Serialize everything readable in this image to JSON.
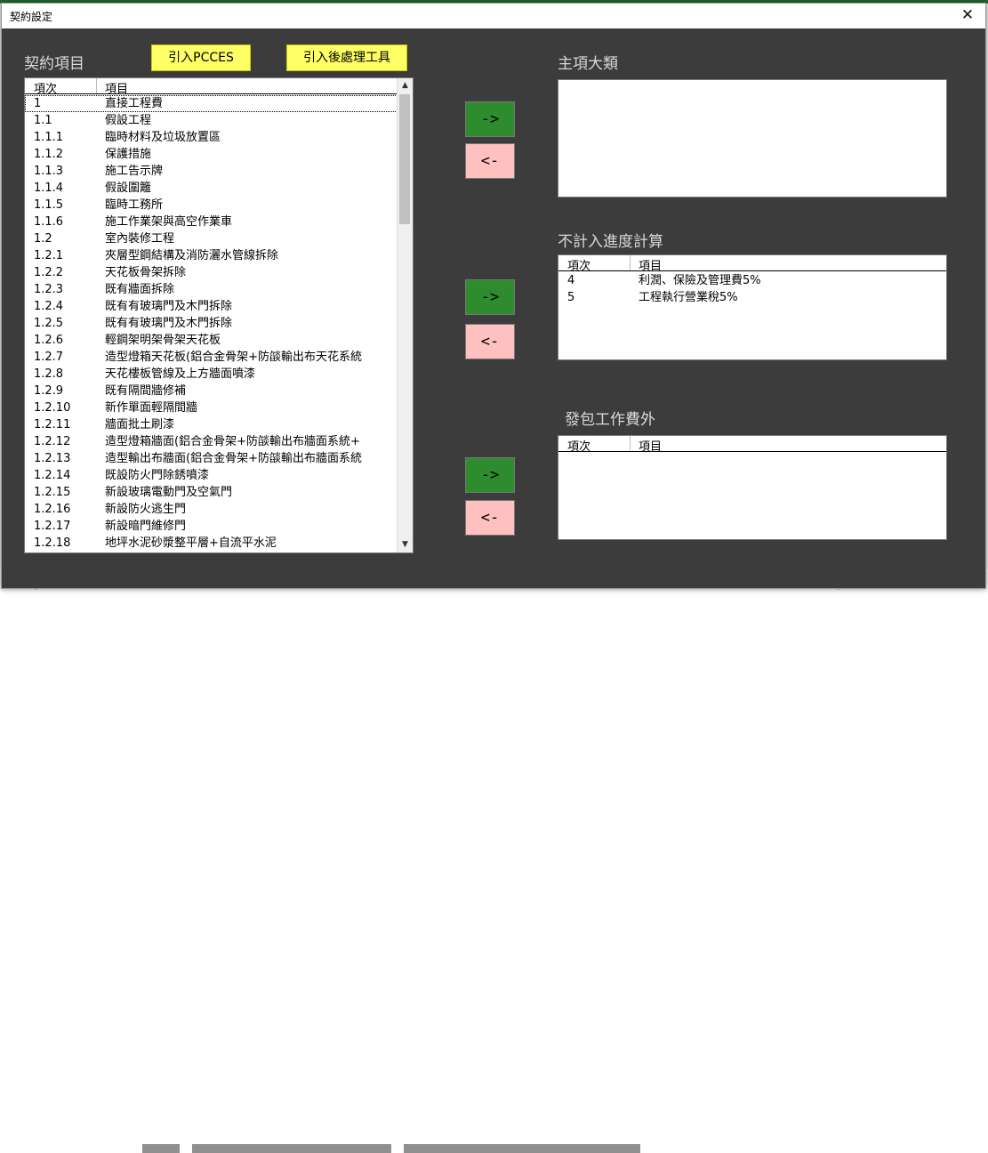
{
  "window": {
    "title": "契約設定",
    "close_symbol": "✕"
  },
  "left": {
    "label": "契約項目",
    "import_pcces": "引入PCCES",
    "import_post": "引入後處理工具",
    "headers": {
      "col1": "項次",
      "col2": "項目"
    },
    "rows": [
      {
        "no": "1",
        "name": "直接工程費"
      },
      {
        "no": "1.1",
        "name": "假設工程"
      },
      {
        "no": "1.1.1",
        "name": "臨時材料及垃圾放置區"
      },
      {
        "no": "1.1.2",
        "name": "保護措施"
      },
      {
        "no": "1.1.3",
        "name": "施工告示牌"
      },
      {
        "no": "1.1.4",
        "name": "假設圍籬"
      },
      {
        "no": "1.1.5",
        "name": "臨時工務所"
      },
      {
        "no": "1.1.6",
        "name": "施工作業架與高空作業車"
      },
      {
        "no": "1.2",
        "name": "室內裝修工程"
      },
      {
        "no": "1.2.1",
        "name": "夾層型鋼結構及消防灑水管線拆除"
      },
      {
        "no": "1.2.2",
        "name": "天花板骨架拆除"
      },
      {
        "no": "1.2.3",
        "name": "既有牆面拆除"
      },
      {
        "no": "1.2.4",
        "name": "既有有玻璃門及木門拆除"
      },
      {
        "no": "1.2.5",
        "name": "既有有玻璃門及木門拆除"
      },
      {
        "no": "1.2.6",
        "name": "輕鋼架明架骨架天花板"
      },
      {
        "no": "1.2.7",
        "name": "造型燈箱天花板(鋁合金骨架+防燄輸出布天花系統"
      },
      {
        "no": "1.2.8",
        "name": "天花樓板管線及上方牆面噴漆"
      },
      {
        "no": "1.2.9",
        "name": "既有隔間牆修補"
      },
      {
        "no": "1.2.10",
        "name": "新作單面輕隔間牆"
      },
      {
        "no": "1.2.11",
        "name": "牆面批土刷漆"
      },
      {
        "no": "1.2.12",
        "name": "造型燈箱牆面(鋁合金骨架+防燄輸出布牆面系統+"
      },
      {
        "no": "1.2.13",
        "name": "造型輸出布牆面(鋁合金骨架+防燄輸出布牆面系統"
      },
      {
        "no": "1.2.14",
        "name": "既設防火門除銹噴漆"
      },
      {
        "no": "1.2.15",
        "name": "新設玻璃電動門及空氣門"
      },
      {
        "no": "1.2.16",
        "name": "新設防火逃生門"
      },
      {
        "no": "1.2.17",
        "name": "新設暗門維修門"
      },
      {
        "no": "1.2.18",
        "name": "地坪水泥砂漿整平層+自流平水泥"
      }
    ]
  },
  "buttons": {
    "move_right": "->",
    "move_left": "<-"
  },
  "main_category": {
    "label": "主項大類"
  },
  "exclude_progress": {
    "label": "不計入進度計算",
    "headers": {
      "col1": "項次",
      "col2": "項目"
    },
    "rows": [
      {
        "no": "4",
        "name": "利潤、保險及管理費5%"
      },
      {
        "no": "5",
        "name": "工程執行營業稅5%"
      }
    ]
  },
  "outsourcing_excluded": {
    "label": "發包工作費外",
    "headers": {
      "col1": "項次",
      "col2": "項目"
    },
    "rows": []
  }
}
